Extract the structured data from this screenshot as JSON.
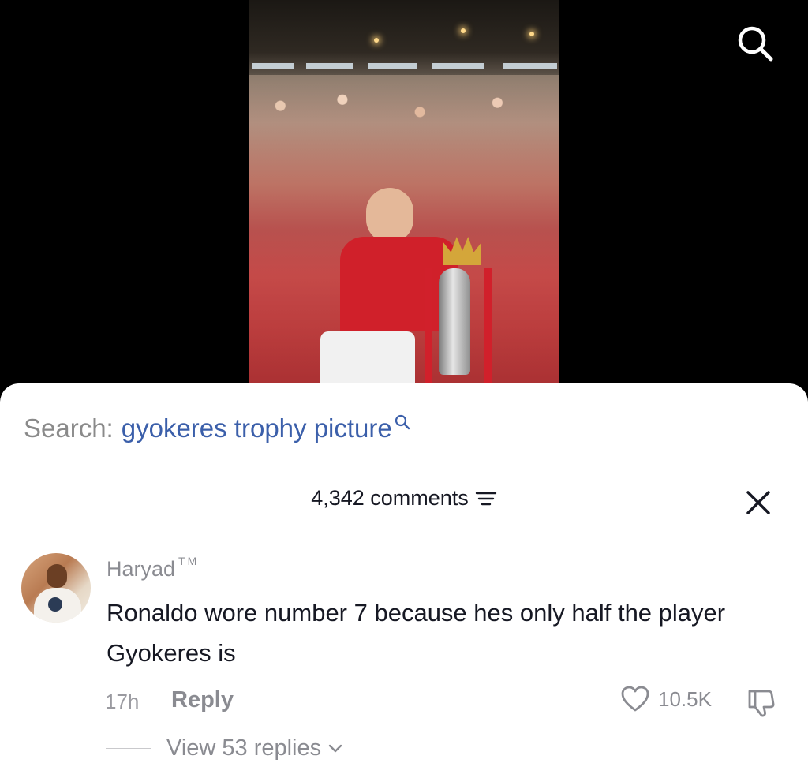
{
  "search": {
    "prefix": "Search:",
    "query": "gyokeres trophy picture"
  },
  "comments_header": {
    "count_label": "4,342 comments"
  },
  "comment": {
    "username": "Haryad",
    "username_suffix": "TM",
    "text": "Ronaldo wore number 7 because hes only half the player Gyokeres is",
    "time": "17h",
    "reply_label": "Reply",
    "likes": "10.5K",
    "view_replies": "View 53 replies"
  },
  "colors": {
    "link_blue": "#3b5faa",
    "secondary_text": "#8a8b91",
    "primary_text": "#161823"
  },
  "icons": [
    "search-icon",
    "filter-icon",
    "close-icon",
    "heart-icon",
    "dislike-icon",
    "chevron-down-icon"
  ]
}
